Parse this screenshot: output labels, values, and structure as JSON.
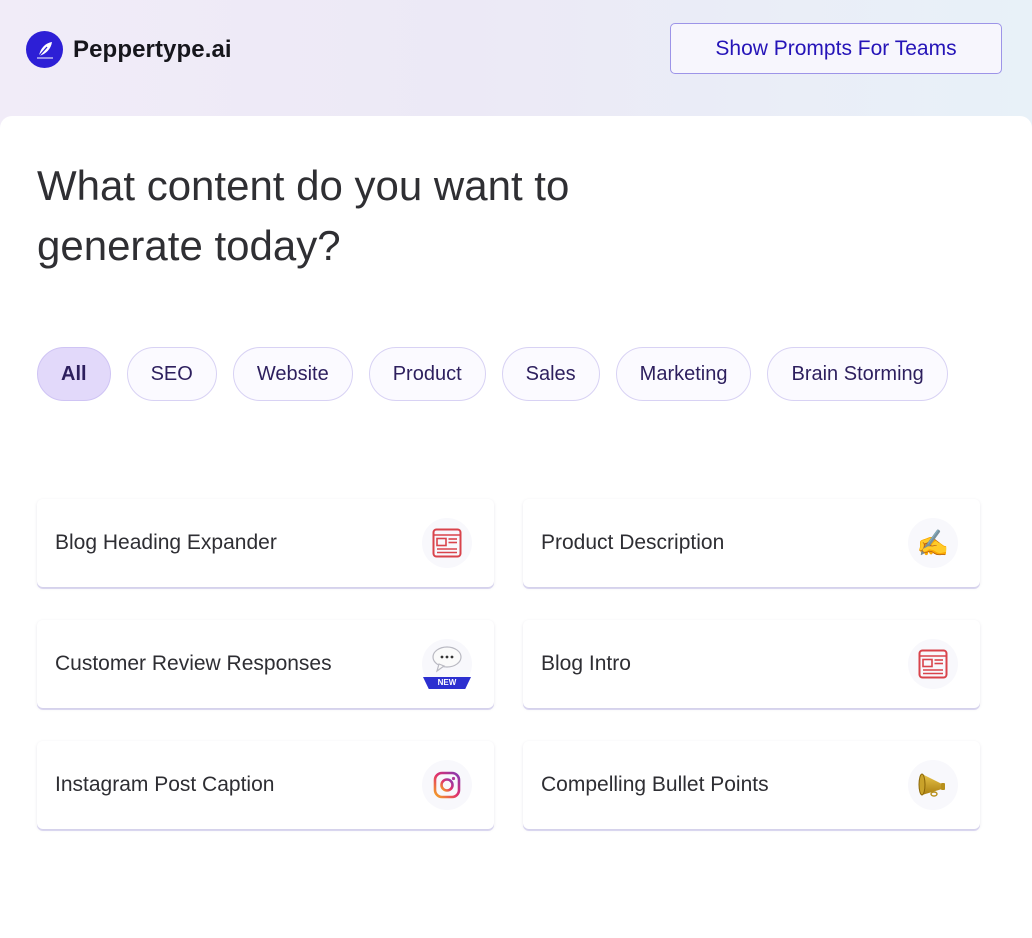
{
  "header": {
    "brand": "Peppertype.ai",
    "logo_icon": "quill-feather-icon",
    "teams_button": "Show Prompts For Teams"
  },
  "main": {
    "title": "What content do you want to generate today?",
    "filters": [
      {
        "label": "All",
        "active": true
      },
      {
        "label": "SEO",
        "active": false
      },
      {
        "label": "Website",
        "active": false
      },
      {
        "label": "Product",
        "active": false
      },
      {
        "label": "Sales",
        "active": false
      },
      {
        "label": "Marketing",
        "active": false
      },
      {
        "label": "Brain Storming",
        "active": false
      }
    ],
    "cards": [
      {
        "label": "Blog Heading Expander",
        "icon": "newspaper-icon"
      },
      {
        "label": "Product Description",
        "icon": "writing-hand-icon",
        "glyph": "✍️"
      },
      {
        "label": "Customer Review Responses",
        "icon": "speech-bubble-icon",
        "badge": "NEW"
      },
      {
        "label": "Blog Intro",
        "icon": "newspaper-icon"
      },
      {
        "label": "Instagram Post Caption",
        "icon": "instagram-icon"
      },
      {
        "label": "Compelling Bullet Points",
        "icon": "megaphone-icon",
        "glyph": "📯"
      }
    ]
  },
  "colors": {
    "brand": "#2d1fd6",
    "button_text": "#2514b8",
    "chip_active_bg": "#e2d9fa",
    "newspaper_red": "#d9434b"
  }
}
